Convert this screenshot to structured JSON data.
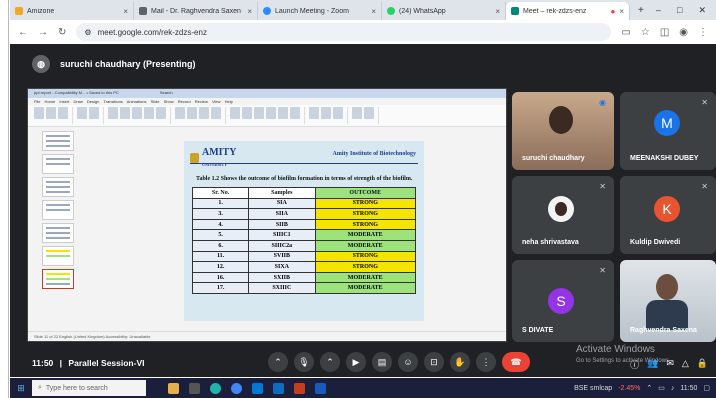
{
  "browser": {
    "tabs": [
      {
        "label": "Amizone",
        "color": "#f5a623",
        "active": false
      },
      {
        "label": "Mail - Dr. Raghvendra Saxen",
        "color": "#5f6368",
        "active": false
      },
      {
        "label": "Launch Meeting - Zoom",
        "color": "#2d8cff",
        "active": false
      },
      {
        "label": "(24) WhatsApp",
        "color": "#25d366",
        "active": false
      },
      {
        "label": "Meet – rek-zdzs-enz",
        "color": "#00897b",
        "active": true
      }
    ],
    "close_glyph": "×",
    "new_tab": "+",
    "minimize": "–",
    "maximize": "□",
    "close": "✕",
    "url": "meet.google.com/rek-zdzs-enz"
  },
  "meet": {
    "presenter_label": "suruchi chaudhary (Presenting)",
    "time": "11:50",
    "separator": "|",
    "meeting_title": "Parallel Session-VI",
    "participants": [
      {
        "name": "suruchi chaudhary",
        "initial": "",
        "color": "#8a6d5a"
      },
      {
        "name": "MEENAKSHI DUBEY",
        "initial": "M",
        "color": "#1a73e8"
      },
      {
        "name": "neha shrivastava",
        "initial": "",
        "color": "#f1f3f4"
      },
      {
        "name": "Kuldip Dwivedi",
        "initial": "K",
        "color": "#e8542f"
      },
      {
        "name": "S DIVATE",
        "initial": "S",
        "color": "#9334e6"
      },
      {
        "name": "Raghvendra Saxena",
        "initial": "",
        "color": "#cfd6dc"
      }
    ],
    "activate_title": "Activate Windows",
    "activate_sub": "Go to Settings to activate Windows."
  },
  "slide": {
    "app_title": "ppt report - Compatibility M... • Saved to this PC",
    "search_label": "Search",
    "menu": "File  Home  Insert  Draw  Design  Transitions  Animations  Slide Show  Record  Review  View  Help",
    "logo": "AMITY",
    "logo_sub": "UNIVERSITY",
    "institute": "Amity Institute of Biotechnology",
    "caption": "Table 1.2 Shows the outcome of biofilm formation in terms of strength of the biofilm.",
    "headers": [
      "Sr. No.",
      "Samples",
      "OUTCOME"
    ],
    "rows": [
      {
        "sr": "1.",
        "sample": "SIA",
        "outcome": "STRONG"
      },
      {
        "sr": "3.",
        "sample": "SIIA",
        "outcome": "STRONG"
      },
      {
        "sr": "4.",
        "sample": "SIIB",
        "outcome": "STRONG"
      },
      {
        "sr": "5.",
        "sample": "SIIIC1",
        "outcome": "MODERATE"
      },
      {
        "sr": "6.",
        "sample": "SIIIC2a",
        "outcome": "MODERATE"
      },
      {
        "sr": "11.",
        "sample": "SVIIB",
        "outcome": "STRONG"
      },
      {
        "sr": "12.",
        "sample": "SIXA",
        "outcome": "STRONG"
      },
      {
        "sr": "16.",
        "sample": "SXIIB",
        "outcome": "MODERATE"
      },
      {
        "sr": "17.",
        "sample": "SXIIIC",
        "outcome": "MODERATE"
      }
    ],
    "status": "Slide 11 of 22   English (United Kingdom)   Accessibility: Unavailable"
  },
  "taskbar": {
    "search_placeholder": "Type here to search",
    "stock": "BSE smlcap",
    "stock_change": "-2.45%",
    "clock": "11:50"
  },
  "colors": {
    "meet_bg": "#202124",
    "tile_bg": "#3c4043",
    "end_call": "#ea4335",
    "strong": "#f5e400",
    "moderate": "#9be37a"
  }
}
